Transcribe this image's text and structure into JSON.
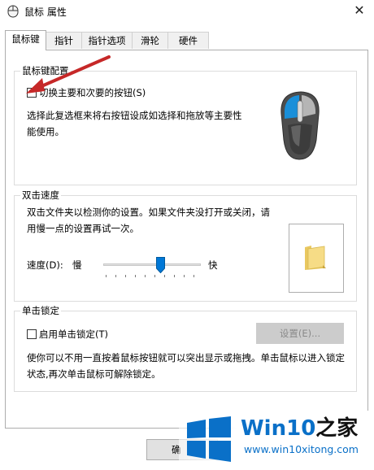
{
  "window": {
    "title": "鼠标 属性",
    "close_glyph": "✕"
  },
  "tabs": [
    {
      "label": "鼠标键",
      "active": true
    },
    {
      "label": "指针"
    },
    {
      "label": "指针选项"
    },
    {
      "label": "滑轮"
    },
    {
      "label": "硬件"
    }
  ],
  "button_config": {
    "title": "鼠标键配置",
    "checkbox_label": "切换主要和次要的按钮(S)",
    "checked": false,
    "description": "选择此复选框来将右按钮设成如选择和拖放等主要性能使用。"
  },
  "double_click": {
    "title": "双击速度",
    "description": "双击文件夹以检测你的设置。如果文件夹没打开或关闭，请用慢一点的设置再试一次。",
    "speed_label": "速度(D):",
    "slow_label": "慢",
    "fast_label": "快",
    "speed_value": 0.6
  },
  "click_lock": {
    "title": "单击锁定",
    "checkbox_label": "启用单击锁定(T)",
    "checked": false,
    "settings_button": "设置(E)...",
    "description": "使你可以不用一直按着鼠标按钮就可以突出显示或拖拽。单击鼠标以进入锁定状态,再次单击鼠标可解除锁定。"
  },
  "footer": {
    "ok_label": "确"
  },
  "watermark": {
    "brand": "Win10",
    "suffix": "之家",
    "url": "www.win10xitong.com"
  },
  "colors": {
    "accent_blue": "#1a8fd9",
    "mouse_body": "#555555",
    "annotation_arrow": "#c62828",
    "watermark_blue": "#0a70c8"
  },
  "icons": [
    "mouse-app-icon",
    "close-icon",
    "mouse-illustration-icon",
    "folder-icon",
    "slider-thumb-icon",
    "windows-logo-icon",
    "annotation-arrow"
  ]
}
